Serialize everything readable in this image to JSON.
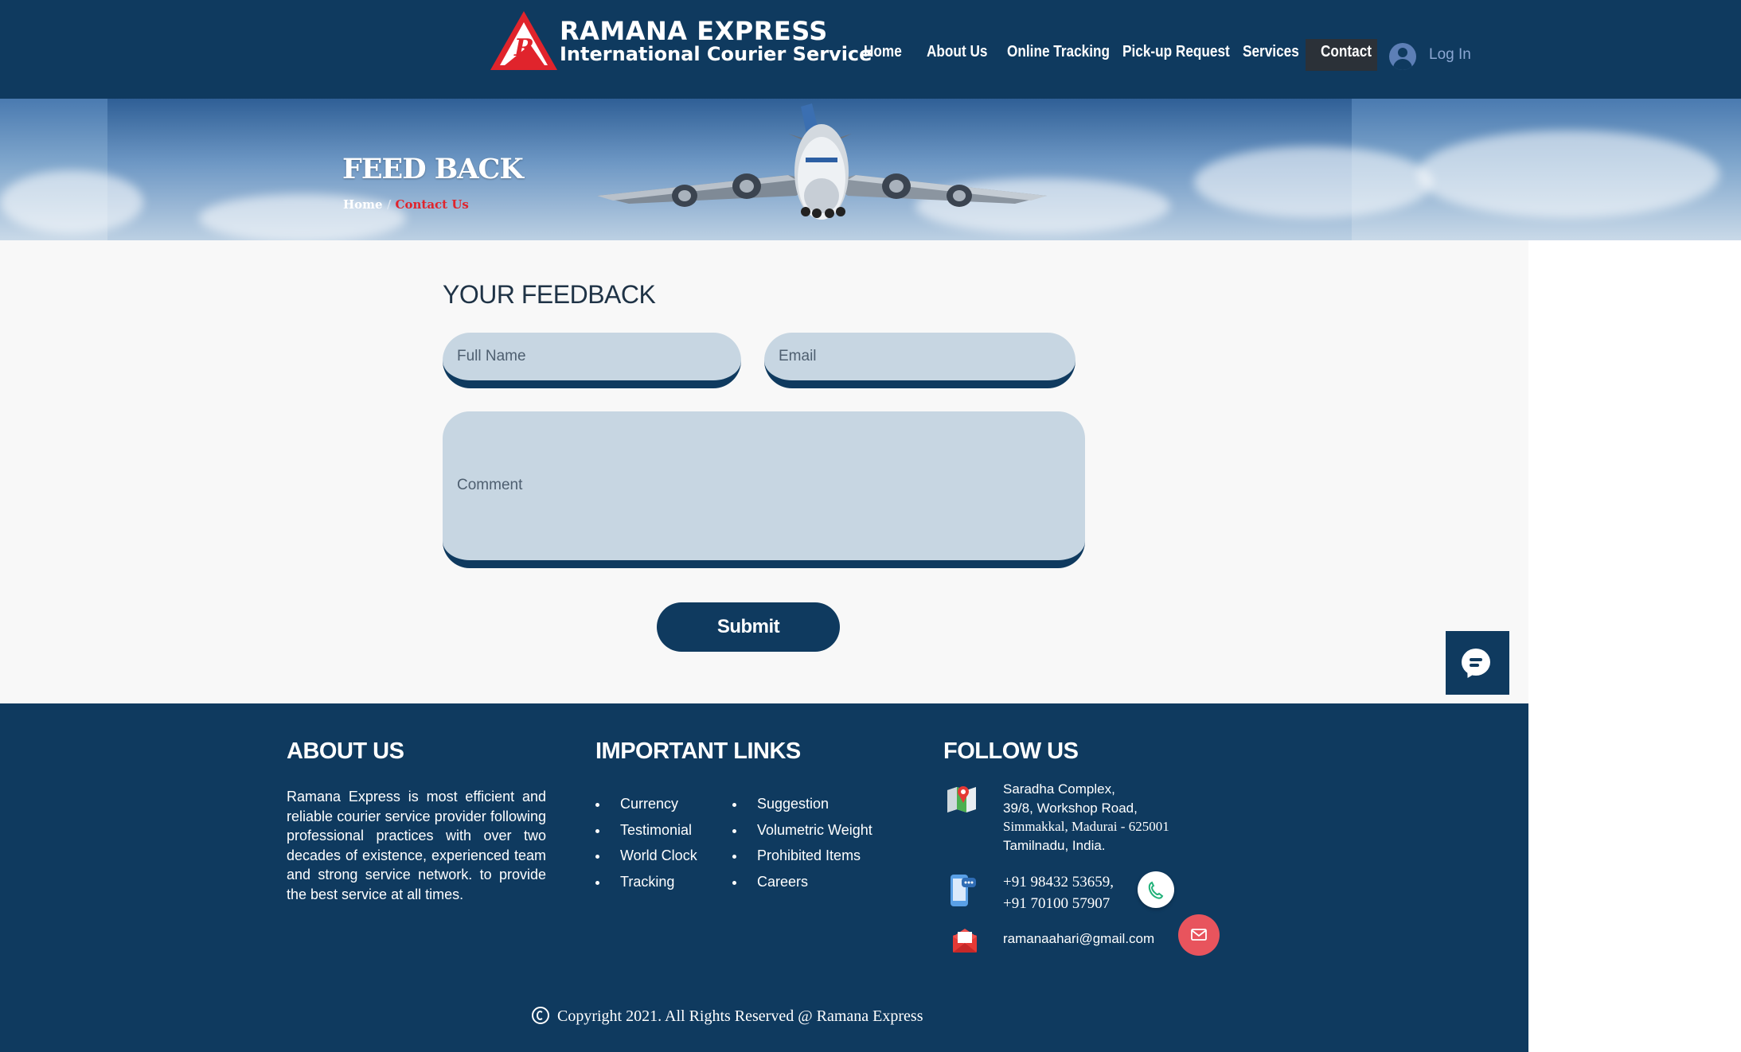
{
  "header": {
    "brand": {
      "title": "RAMANA EXPRESS",
      "subtitle": "International Courier Service"
    },
    "nav": [
      {
        "label": "Home"
      },
      {
        "label": "About Us"
      },
      {
        "label": "Online Tracking"
      },
      {
        "label": "Pick-up Request"
      },
      {
        "label": "Services"
      },
      {
        "label": "Contact",
        "active": true
      }
    ],
    "login_label": "Log In"
  },
  "banner": {
    "title": "FEED BACK",
    "breadcrumb": {
      "home": "Home",
      "separator": "/",
      "current": "Contact Us"
    }
  },
  "form": {
    "title": "YOUR FEEDBACK",
    "name_placeholder": "Full Name",
    "email_placeholder": "Email",
    "comment_placeholder": "Comment",
    "name_value": "",
    "email_value": "",
    "comment_value": "",
    "submit_label": "Submit"
  },
  "footer": {
    "about": {
      "heading": "ABOUT US",
      "text": "Ramana Express is most efficient and reliable courier service provider following professional practices with over two decades of existence, experienced team and strong service network. to provide the best service at all times."
    },
    "links": {
      "heading": "IMPORTANT LINKS",
      "left": [
        "Currency",
        "Testimonial",
        "World Clock",
        "Tracking"
      ],
      "right": [
        "Suggestion",
        "Volumetric Weight",
        "Prohibited Items",
        "Careers"
      ]
    },
    "follow": {
      "heading": "FOLLOW US",
      "address": [
        "Saradha Complex,",
        "39/8, Workshop Road,",
        "Simmakkal, Madurai - 625001",
        "Tamilnadu, India."
      ],
      "phones": [
        "+91 98432  53659,",
        "+91 70100  57907"
      ],
      "email": "ramanaahari@gmail.com"
    },
    "copyright": "Copyright 2021. All Rights Reserved @ Ramana Express"
  },
  "colors": {
    "navy": "#0f3a5f",
    "field_bg": "#c7d6e2",
    "accent_red": "#e0242c",
    "email_button": "#e8545d",
    "contact_nav_bg": "#2b3138"
  },
  "icons": [
    "logo-mark",
    "user-avatar-icon",
    "airplane-image",
    "chat-icon",
    "map-pin-icon",
    "phone-icon",
    "envelope-icon",
    "call-icon",
    "mail-icon",
    "copyright-icon"
  ]
}
